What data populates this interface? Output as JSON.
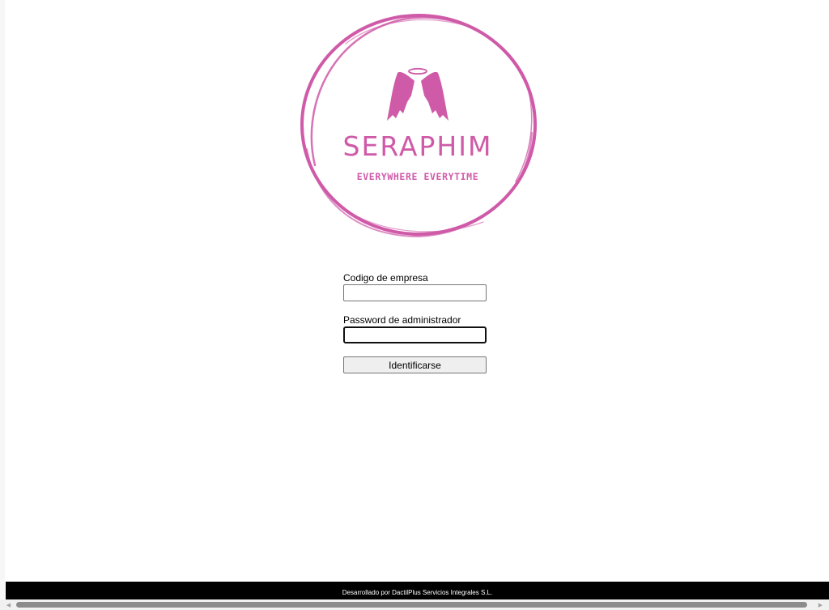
{
  "brand": {
    "name": "SERAPHIM",
    "tagline": "EVERYWHERE EVERYTIME",
    "color": "#cf5aa8"
  },
  "form": {
    "company_label": "Codigo de empresa",
    "company_value": "",
    "password_label": "Password de administrador",
    "password_value": "",
    "submit_label": "Identificarse"
  },
  "footer": {
    "text": "Desarrollado por DactilPlus Servicios Integrales S.L."
  },
  "icons": {
    "logo": "angel-wings-halo-icon",
    "scroll_left": "arrow-left-icon",
    "scroll_right": "arrow-right-icon"
  }
}
